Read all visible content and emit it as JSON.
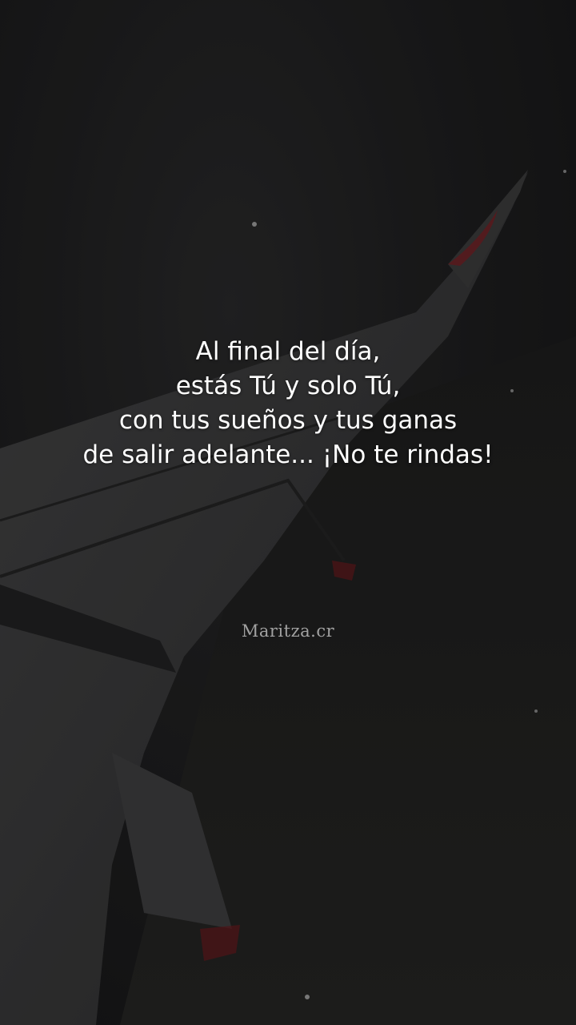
{
  "quote": {
    "lines": [
      "Al final del día,",
      "estás Tú y solo Tú,",
      "con tus sueños y tus ganas",
      "de salir adelante... ¡No te rindas!"
    ]
  },
  "watermark": "Maritza.cr",
  "colors": {
    "background": "#1c1c1d",
    "wing": "#3a3a3b",
    "wing_tip_accent": "#7a1f24",
    "text": "#ffffff"
  }
}
